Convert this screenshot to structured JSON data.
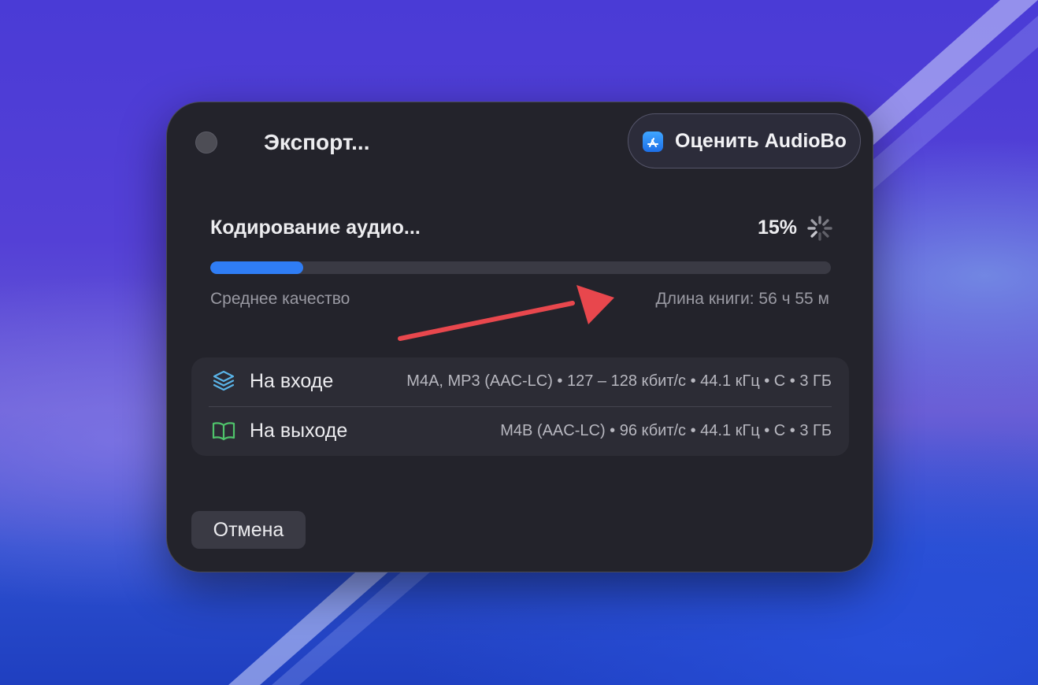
{
  "window": {
    "title": "Экспорт...",
    "rate_button_label": "Оценить AudioBo"
  },
  "progress": {
    "status_label": "Кодирование аудио...",
    "percent_text": "15%",
    "value": 0.15,
    "quality_label": "Среднее качество",
    "book_length_label": "Длина книги: 56 ч 55 м"
  },
  "info": {
    "input": {
      "label": "На входе",
      "value": "M4A, MP3 (AAC-LC) • 127 – 128 кбит/с • 44.1 кГц • С • 3 ГБ",
      "icon": "layers-icon"
    },
    "output": {
      "label": "На выходе",
      "value": "M4B (AAC-LC) • 96 кбит/с • 44.1 кГц • С • 3 ГБ",
      "icon": "book-icon"
    }
  },
  "footer": {
    "cancel_label": "Отмена"
  },
  "colors": {
    "accent": "#2f7df5",
    "annotation_arrow": "#e8474d",
    "input_icon": "#5ab4e8",
    "output_icon": "#4fc36b"
  }
}
